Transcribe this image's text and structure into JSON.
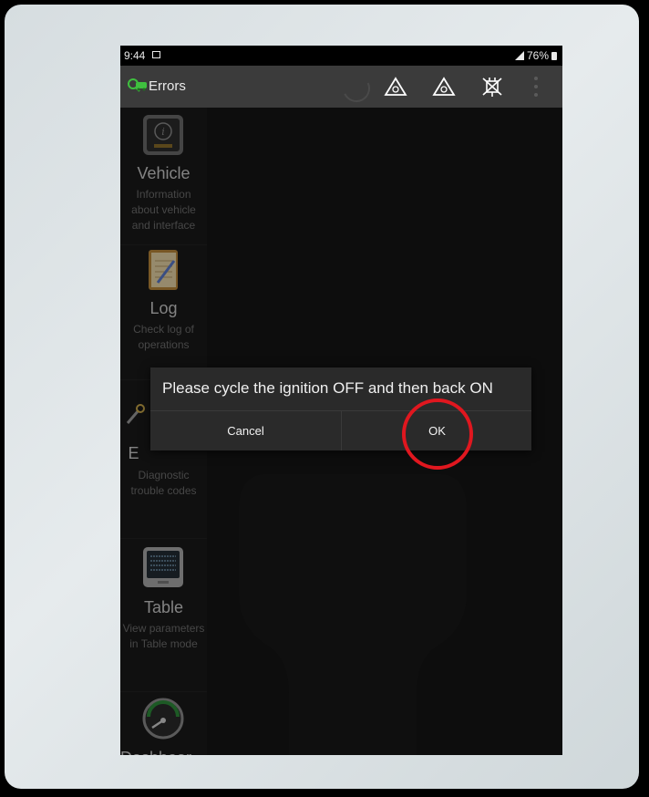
{
  "status_bar": {
    "time": "9:44",
    "battery": "76%"
  },
  "app_bar": {
    "title": "Errors",
    "icons": [
      "app-logo-icon",
      "spinner-icon",
      "warning-triangle-icon",
      "warning-triangle-icon",
      "no-connection-icon",
      "overflow-menu-icon"
    ]
  },
  "sidebar": {
    "items": [
      {
        "label": "Vehicle",
        "desc": "Information about vehicle and interface",
        "icon": "vehicle-info-icon"
      },
      {
        "label": "Log",
        "desc": "Check log of operations",
        "icon": "log-notebook-icon"
      },
      {
        "label": "E",
        "desc": "Diagnostic trouble codes",
        "icon": "errors-wrench-icon"
      },
      {
        "label": "Table",
        "desc": "View parameters in Table mode",
        "icon": "table-screen-icon"
      },
      {
        "label": "Dashboar d",
        "desc": "",
        "icon": "dashboard-gauge-icon"
      }
    ]
  },
  "dialog": {
    "message": "Please cycle the ignition OFF and then back ON",
    "cancel_label": "Cancel",
    "ok_label": "OK"
  },
  "colors": {
    "annotation": "#e0171f",
    "dialog_bg": "#2a2a2a",
    "app_bar_bg": "#3b3b3b"
  }
}
